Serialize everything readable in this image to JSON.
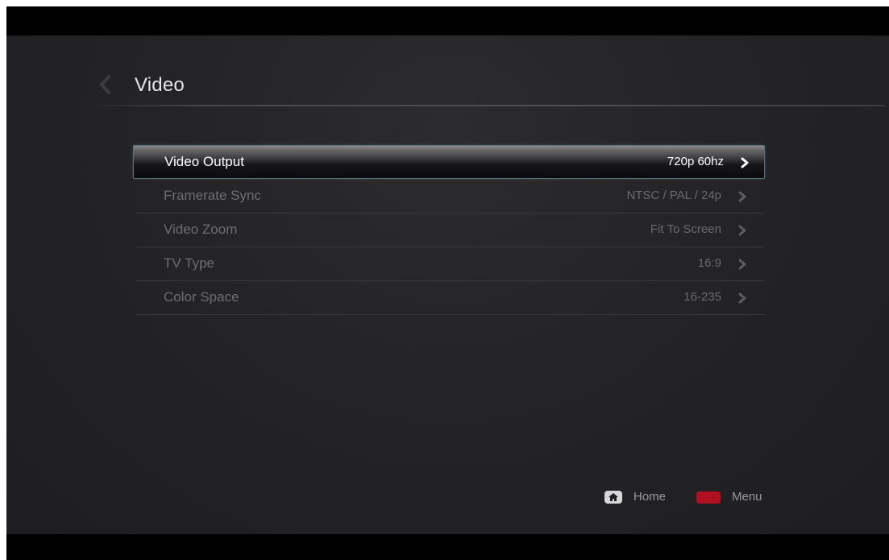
{
  "header": {
    "title": "Video",
    "back_icon": "chevron-left-icon"
  },
  "menu": {
    "items": [
      {
        "label": "Video Output",
        "value": "720p 60hz",
        "selected": true
      },
      {
        "label": "Framerate Sync",
        "value": "NTSC / PAL / 24p",
        "selected": false
      },
      {
        "label": "Video Zoom",
        "value": "Fit To Screen",
        "selected": false
      },
      {
        "label": "TV Type",
        "value": "16:9",
        "selected": false
      },
      {
        "label": "Color Space",
        "value": "16-235",
        "selected": false
      }
    ]
  },
  "footer": {
    "home_label": "Home",
    "home_icon": "home-icon",
    "menu_label": "Menu",
    "menu_icon": "red-key-icon"
  },
  "colors": {
    "background": "#242426",
    "selected_border": "#5a7078",
    "menu_key": "#b01020",
    "text_dim": "#6e6e70",
    "text_bright": "#ffffff"
  }
}
